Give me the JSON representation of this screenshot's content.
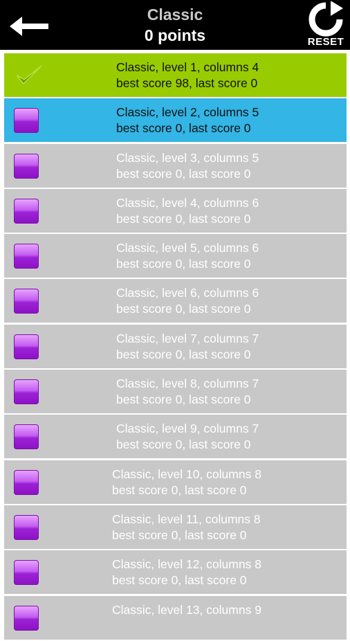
{
  "header": {
    "title": "Classic",
    "points": "0 points",
    "reset_label": "RESET"
  },
  "levels": [
    {
      "line1": "Classic, level 1, columns 4",
      "line2": "best score 98, last score 0",
      "status": "done"
    },
    {
      "line1": "Classic, level 2, columns 5",
      "line2": "best score 0, last score 0",
      "status": "current"
    },
    {
      "line1": "Classic, level 3, columns 5",
      "line2": "best score 0, last score 0",
      "status": "locked"
    },
    {
      "line1": "Classic, level 4, columns 6",
      "line2": "best score 0, last score 0",
      "status": "locked"
    },
    {
      "line1": "Classic, level 5, columns 6",
      "line2": "best score 0, last score 0",
      "status": "locked"
    },
    {
      "line1": "Classic, level 6, columns 6",
      "line2": "best score 0, last score 0",
      "status": "locked"
    },
    {
      "line1": "Classic, level 7, columns 7",
      "line2": "best score 0, last score 0",
      "status": "locked"
    },
    {
      "line1": "Classic, level 8, columns 7",
      "line2": "best score 0, last score 0",
      "status": "locked"
    },
    {
      "line1": "Classic, level 9, columns 7",
      "line2": "best score 0, last score 0",
      "status": "locked"
    },
    {
      "line1": "Classic, level 10, columns 8",
      "line2": "best score 0, last score 0",
      "status": "locked"
    },
    {
      "line1": "Classic, level 11, columns 8",
      "line2": "best score 0, last score 0",
      "status": "locked"
    },
    {
      "line1": "Classic, level 12, columns 8",
      "line2": "best score 0, last score 0",
      "status": "locked"
    },
    {
      "line1": "Classic, level 13, columns 9",
      "line2": "",
      "status": "locked"
    }
  ],
  "colors": {
    "done": "#99cc00",
    "current": "#33b5e5",
    "locked": "#c8c8c8",
    "level_box": "#a633dd"
  },
  "icons": {
    "back": "arrow-left-icon",
    "reset": "refresh-icon",
    "done": "checkmark-icon",
    "level": "purple-box-icon"
  }
}
